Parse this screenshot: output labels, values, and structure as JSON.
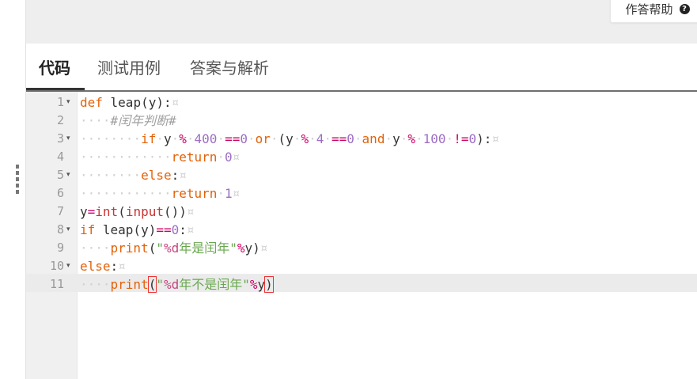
{
  "help_button": {
    "label": "作答帮助",
    "icon": "question-circle-icon"
  },
  "tabs": [
    {
      "label": "代码",
      "active": true
    },
    {
      "label": "测试用例",
      "active": false
    },
    {
      "label": "答案与解析",
      "active": false
    }
  ],
  "editor": {
    "line_numbers": [
      "1",
      "2",
      "3",
      "4",
      "5",
      "6",
      "7",
      "8",
      "9",
      "10",
      "11"
    ],
    "active_line": "11",
    "lines": [
      [
        {
          "t": "def",
          "c": "kw"
        },
        {
          "t": " leap(y):",
          "c": "plain"
        },
        {
          "t": "¤",
          "c": "inv"
        }
      ],
      [
        {
          "t": "····",
          "c": "inv"
        },
        {
          "t": "#闰年判断",
          "c": "cm"
        },
        {
          "t": "#",
          "c": "cm"
        }
      ],
      [
        {
          "t": "········",
          "c": "inv"
        },
        {
          "t": "if",
          "c": "kw"
        },
        {
          "t": "·",
          "c": "inv"
        },
        {
          "t": "y",
          "c": "plain"
        },
        {
          "t": "·",
          "c": "inv"
        },
        {
          "t": "%",
          "c": "op"
        },
        {
          "t": "·",
          "c": "inv"
        },
        {
          "t": "400",
          "c": "num"
        },
        {
          "t": "·",
          "c": "inv"
        },
        {
          "t": "==",
          "c": "op"
        },
        {
          "t": "0",
          "c": "num"
        },
        {
          "t": "·",
          "c": "inv"
        },
        {
          "t": "or",
          "c": "kw"
        },
        {
          "t": "·",
          "c": "inv"
        },
        {
          "t": "(y",
          "c": "plain"
        },
        {
          "t": "·",
          "c": "inv"
        },
        {
          "t": "%",
          "c": "op"
        },
        {
          "t": "·",
          "c": "inv"
        },
        {
          "t": "4",
          "c": "num"
        },
        {
          "t": "·",
          "c": "inv"
        },
        {
          "t": "==",
          "c": "op"
        },
        {
          "t": "0",
          "c": "num"
        },
        {
          "t": "·",
          "c": "inv"
        },
        {
          "t": "and",
          "c": "kw"
        },
        {
          "t": "·",
          "c": "inv"
        },
        {
          "t": "y",
          "c": "plain"
        },
        {
          "t": "·",
          "c": "inv"
        },
        {
          "t": "%",
          "c": "op"
        },
        {
          "t": "·",
          "c": "inv"
        },
        {
          "t": "100",
          "c": "num"
        },
        {
          "t": "·",
          "c": "inv"
        },
        {
          "t": "!=",
          "c": "op"
        },
        {
          "t": "0",
          "c": "num"
        },
        {
          "t": "):",
          "c": "plain"
        },
        {
          "t": "¤",
          "c": "inv"
        }
      ],
      [
        {
          "t": "············",
          "c": "inv"
        },
        {
          "t": "return",
          "c": "kw"
        },
        {
          "t": "·",
          "c": "inv"
        },
        {
          "t": "0",
          "c": "num"
        },
        {
          "t": "¤",
          "c": "inv"
        }
      ],
      [
        {
          "t": "········",
          "c": "inv"
        },
        {
          "t": "else",
          "c": "kw"
        },
        {
          "t": ":",
          "c": "plain"
        },
        {
          "t": "¤",
          "c": "inv"
        }
      ],
      [
        {
          "t": "············",
          "c": "inv"
        },
        {
          "t": "return",
          "c": "kw"
        },
        {
          "t": "·",
          "c": "inv"
        },
        {
          "t": "1",
          "c": "num"
        },
        {
          "t": "¤",
          "c": "inv"
        }
      ],
      [
        {
          "t": "y",
          "c": "plain"
        },
        {
          "t": "=",
          "c": "op"
        },
        {
          "t": "int",
          "c": "bfun"
        },
        {
          "t": "(",
          "c": "plain"
        },
        {
          "t": "input",
          "c": "bfun"
        },
        {
          "t": "())",
          "c": "plain"
        },
        {
          "t": "¤",
          "c": "inv"
        }
      ],
      [
        {
          "t": "if",
          "c": "kw"
        },
        {
          "t": " leap(y)",
          "c": "plain"
        },
        {
          "t": "==",
          "c": "op"
        },
        {
          "t": "0",
          "c": "num"
        },
        {
          "t": ":",
          "c": "plain"
        },
        {
          "t": "¤",
          "c": "inv"
        }
      ],
      [
        {
          "t": "····",
          "c": "inv"
        },
        {
          "t": "print",
          "c": "kw"
        },
        {
          "t": "(",
          "c": "plain"
        },
        {
          "t": "\"",
          "c": "str"
        },
        {
          "t": "%d",
          "c": "fmt"
        },
        {
          "t": "年是闰年\"",
          "c": "str"
        },
        {
          "t": "%",
          "c": "op"
        },
        {
          "t": "y)",
          "c": "plain"
        },
        {
          "t": "¤",
          "c": "inv"
        }
      ],
      [
        {
          "t": "else",
          "c": "kw"
        },
        {
          "t": ":",
          "c": "plain"
        },
        {
          "t": "¤",
          "c": "inv"
        }
      ],
      [
        {
          "t": "····",
          "c": "inv"
        },
        {
          "t": "print",
          "c": "kw"
        },
        {
          "t": "(",
          "c": "plain bracket-hl"
        },
        {
          "t": "\"",
          "c": "str"
        },
        {
          "t": "%d",
          "c": "fmt"
        },
        {
          "t": "年不是闰年\"",
          "c": "str"
        },
        {
          "t": "%",
          "c": "op"
        },
        {
          "t": "y",
          "c": "plain"
        },
        {
          "t": ")",
          "c": "plain bracket-hl"
        }
      ]
    ],
    "folds": [
      "1",
      "3",
      "5",
      "8",
      "10"
    ]
  }
}
